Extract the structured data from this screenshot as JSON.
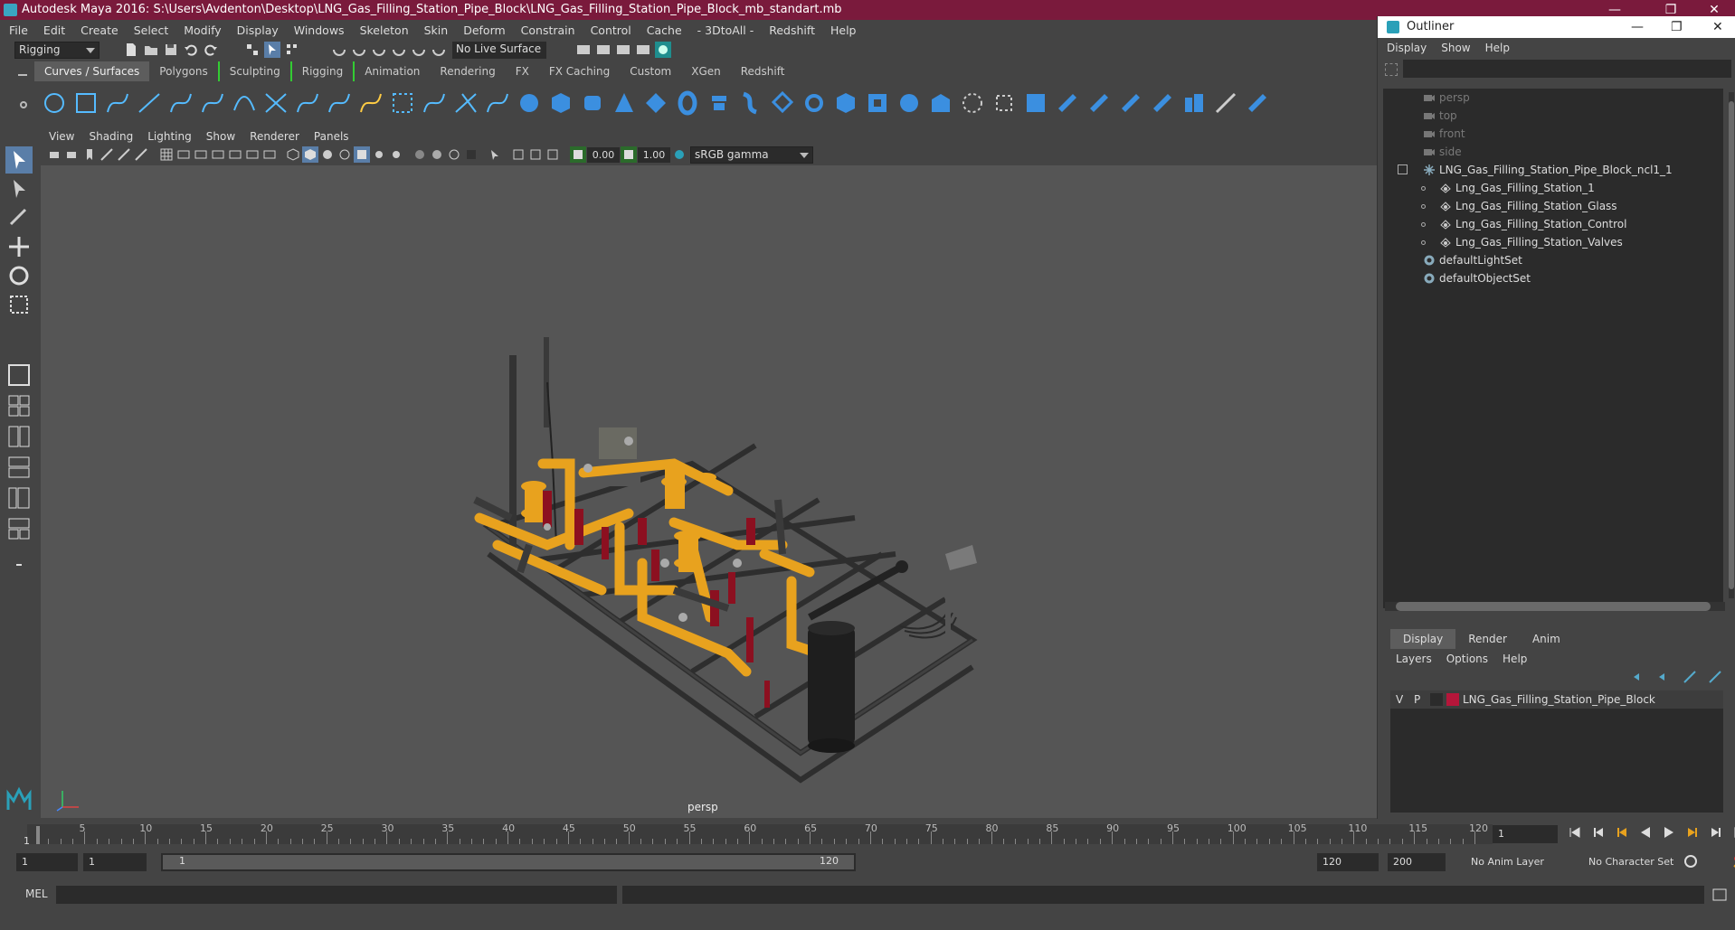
{
  "titlebar": {
    "title": "Autodesk Maya 2016: S:\\Users\\Avdenton\\Desktop\\LNG_Gas_Filling_Station_Pipe_Block\\LNG_Gas_Filling_Station_Pipe_Block_mb_standart.mb",
    "minimize": "—",
    "restore": "❐",
    "close": "✕"
  },
  "menubar": [
    "File",
    "Edit",
    "Create",
    "Select",
    "Modify",
    "Display",
    "Windows",
    "Skeleton",
    "Skin",
    "Deform",
    "Constrain",
    "Control",
    "Cache",
    "- 3DtoAll -",
    "Redshift",
    "Help"
  ],
  "statusline": {
    "mode": "Rigging",
    "live_surface": "No Live Surface"
  },
  "shelf_tabs": [
    "Curves / Surfaces",
    "Polygons",
    "Sculpting",
    "Rigging",
    "Animation",
    "Rendering",
    "FX",
    "FX Caching",
    "Custom",
    "XGen",
    "Redshift"
  ],
  "viewport": {
    "menu": [
      "View",
      "Shading",
      "Lighting",
      "Show",
      "Renderer",
      "Panels"
    ],
    "exposure": "0.00",
    "gamma": "1.00",
    "color_space": "sRGB gamma",
    "camera_label": "persp"
  },
  "timeline": {
    "ticks": [
      "5",
      "10",
      "15",
      "20",
      "25",
      "30",
      "35",
      "40",
      "45",
      "50",
      "55",
      "60",
      "65",
      "70",
      "75",
      "80",
      "85",
      "90",
      "95",
      "100",
      "105",
      "110",
      "115",
      "120"
    ],
    "current_frame": "1",
    "start_tick": "1"
  },
  "range": {
    "start": "1",
    "start2": "1",
    "slider_start": "1",
    "slider_end": "120",
    "end": "120",
    "end2": "200",
    "anim_layer": "No Anim Layer",
    "character_set": "No Character Set"
  },
  "cmdline": {
    "label": "MEL"
  },
  "outliner": {
    "title": "Outliner",
    "menu": [
      "Display",
      "Show",
      "Help"
    ],
    "items": [
      {
        "name": "persp",
        "type": "camera",
        "dim": true
      },
      {
        "name": "top",
        "type": "camera",
        "dim": true
      },
      {
        "name": "front",
        "type": "camera",
        "dim": true
      },
      {
        "name": "side",
        "type": "camera",
        "dim": true
      },
      {
        "name": "LNG_Gas_Filling_Station_Pipe_Block_ncl1_1",
        "type": "group",
        "dim": false
      },
      {
        "name": "Lng_Gas_Filling_Station_1",
        "type": "mesh",
        "dim": false
      },
      {
        "name": "Lng_Gas_Filling_Station_Glass",
        "type": "mesh",
        "dim": false
      },
      {
        "name": "Lng_Gas_Filling_Station_Control",
        "type": "mesh",
        "dim": false
      },
      {
        "name": "Lng_Gas_Filling_Station_Valves",
        "type": "mesh",
        "dim": false
      },
      {
        "name": "defaultLightSet",
        "type": "set",
        "dim": false
      },
      {
        "name": "defaultObjectSet",
        "type": "set",
        "dim": false
      }
    ]
  },
  "channel": {
    "tabs": [
      "Display",
      "Render",
      "Anim"
    ],
    "menu": [
      "Layers",
      "Options",
      "Help"
    ],
    "layer": {
      "v": "V",
      "p": "P",
      "name": "LNG_Gas_Filling_Station_Pipe_Block",
      "color": "#b5163a"
    }
  },
  "colors": {
    "title_bg": "#7a1a3c",
    "pipe": "#e8a21e",
    "valve_red": "#8c1020",
    "frame": "#3a3a3a"
  }
}
